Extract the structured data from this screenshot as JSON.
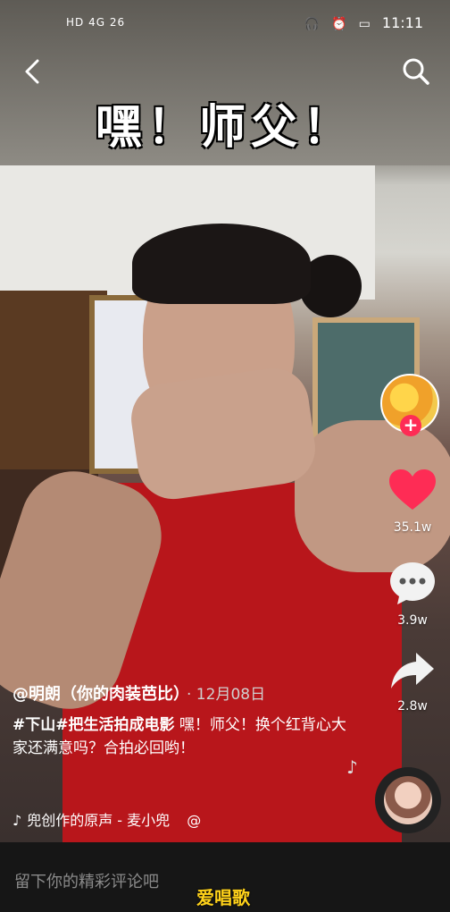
{
  "status_bar": {
    "left_text": "HD 4G 26",
    "time": "11:11"
  },
  "video_caption": "嘿！师父！",
  "right_rail": {
    "likes": "35.1w",
    "comments": "3.9w",
    "shares": "2.8w",
    "follow_symbol": "+"
  },
  "post": {
    "author": "@明朗（你的肉装芭比）",
    "date": "· 12月08日",
    "hashtag_1": "#下山",
    "hashtag_2": "#把生活拍成电影",
    "text": " 嘿！师父！换个红背心大家还满意吗？合拍必回哟！",
    "music": "兜创作的原声 - 麦小兜",
    "music_mention": "@"
  },
  "comment_placeholder": "留下你的精彩评论吧",
  "watermark": "爱唱歌",
  "colors": {
    "like_red": "#fe2c55",
    "watermark_yellow": "#ffd21a"
  }
}
